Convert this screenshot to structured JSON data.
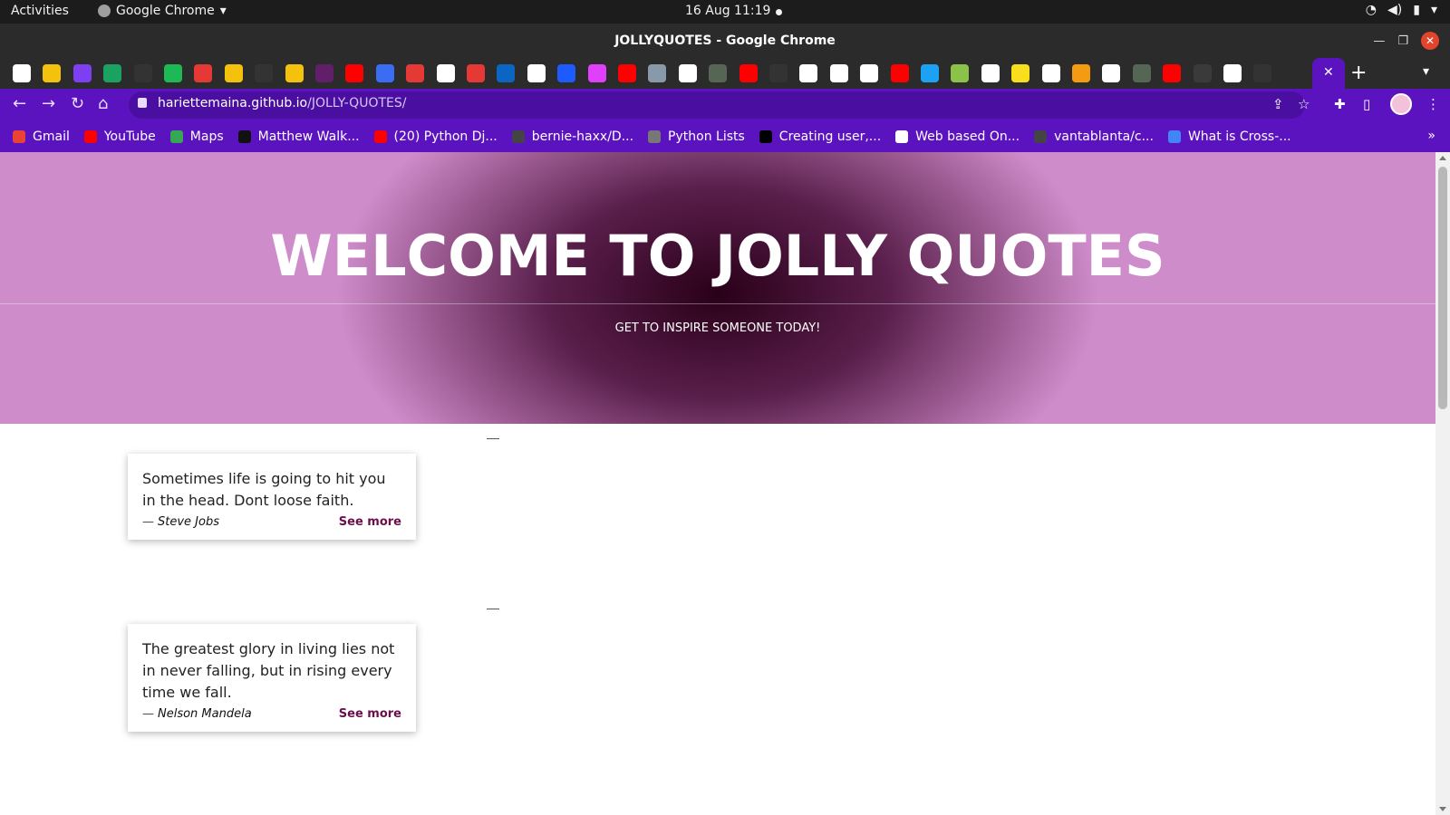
{
  "system_bar": {
    "activities": "Activities",
    "app_name": "Google Chrome",
    "clock": "16 Aug  11:19"
  },
  "window": {
    "title": "JOLLYQUOTES - Google Chrome"
  },
  "tabs": {
    "count": 42,
    "favicon_colors": [
      "#ffffff",
      "#f4c20d",
      "#7e3ff2",
      "#1aa260",
      "#333333",
      "#1db954",
      "#e53935",
      "#f4c20d",
      "#333333",
      "#f4c20d",
      "#611f69",
      "#ff0000",
      "#3a6cf4",
      "#e53935",
      "#ffffff",
      "#e53935",
      "#0a66c2",
      "#ffffff",
      "#1e5bff",
      "#e040fb",
      "#ff0000",
      "#8899aa",
      "#ffffff",
      "#556655",
      "#ff0000",
      "#333333",
      "#ffffff",
      "#ffffff",
      "#ffffff",
      "#ff0000",
      "#1da1f2",
      "#8bc34a",
      "#ffffff",
      "#f7df1e",
      "#ffffff",
      "#f39c12",
      "#ffffff",
      "#556655",
      "#ff0000",
      "#3a3a3a",
      "#ffffff",
      "#333333"
    ]
  },
  "toolbar": {
    "url_host": "hariettemaina.github.io",
    "url_path": "/JOLLY-QUOTES/"
  },
  "bookmarks": [
    {
      "label": "Gmail",
      "color": "#ea4335"
    },
    {
      "label": "YouTube",
      "color": "#ff0000"
    },
    {
      "label": "Maps",
      "color": "#34a853"
    },
    {
      "label": "Matthew Walk...",
      "color": "#111111"
    },
    {
      "label": "(20) Python Dj...",
      "color": "#ff0000"
    },
    {
      "label": "bernie-haxx/D...",
      "color": "#444444"
    },
    {
      "label": "Python Lists",
      "color": "#777777"
    },
    {
      "label": "Creating user,...",
      "color": "#000000"
    },
    {
      "label": "Web based On...",
      "color": "#ffffff"
    },
    {
      "label": "vantablanta/c...",
      "color": "#444444"
    },
    {
      "label": "What is Cross-...",
      "color": "#4285f4"
    }
  ],
  "hero": {
    "title": "WELCOME TO JOLLY QUOTES",
    "tagline": "GET TO INSPIRE SOMEONE TODAY!"
  },
  "quotes": [
    {
      "text": "Sometimes life is going to hit you in the head. Dont loose faith.",
      "dash": "—",
      "author": "Steve Jobs",
      "see_more": "See more"
    },
    {
      "text": "The greatest glory in living lies not in never falling, but in rising every time we fall.",
      "dash": "—",
      "author": "Nelson Mandela",
      "see_more": "See more"
    }
  ]
}
